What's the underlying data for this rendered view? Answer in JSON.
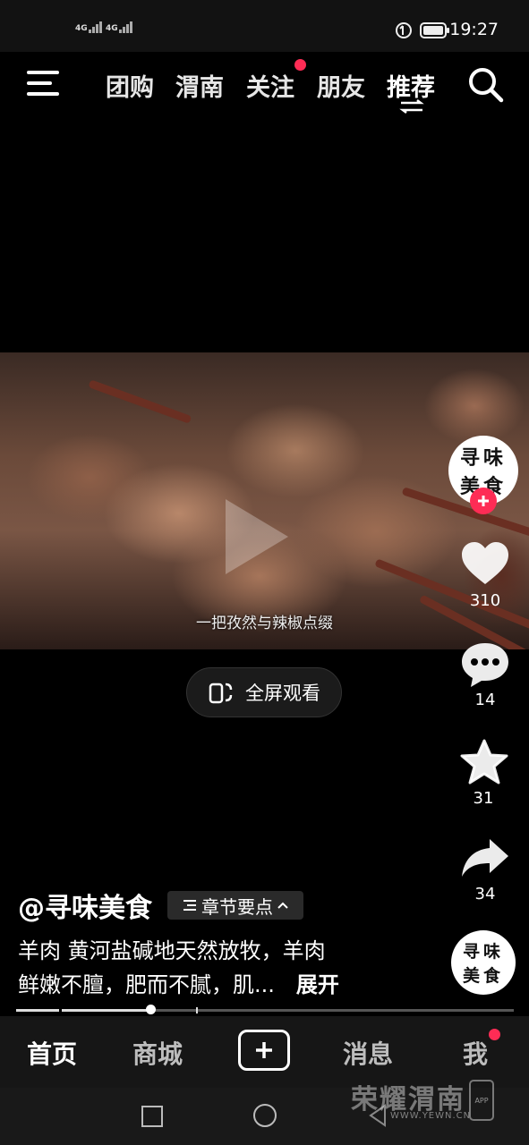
{
  "status_bar": {
    "sim1": "4G",
    "sim2": "4G",
    "time": "19:27"
  },
  "top_nav": {
    "tabs": [
      {
        "label": "团购"
      },
      {
        "label": "渭南"
      },
      {
        "label": "关注",
        "has_dot": true
      },
      {
        "label": "朋友"
      },
      {
        "label": "推荐",
        "active": true
      }
    ]
  },
  "video": {
    "subtitle": "一把孜然与辣椒点缀"
  },
  "fullscreen_button": {
    "label": "全屏观看"
  },
  "right_rail": {
    "avatar_text_line1": "寻味",
    "avatar_text_line2": "美食",
    "likes": "310",
    "comments": "14",
    "favorites": "31",
    "shares": "34"
  },
  "post": {
    "author": "@寻味美食",
    "chapter_label": "章节要点",
    "description_line1": "羊肉 黄河盐碱地天然放牧，羊肉",
    "description_line2": "鲜嫩不膻，肥而不腻，肌...",
    "expand_label": "展开"
  },
  "progress": {
    "played_fraction": 0.27
  },
  "bottom_tabs": {
    "home": "首页",
    "mall": "商城",
    "messages": "消息",
    "me": "我"
  },
  "watermark": {
    "text": "荣耀渭南",
    "url": "WWW.YEWN.CN",
    "app_label": "APP"
  },
  "colors": {
    "accent_red": "#fe2c55",
    "background": "#000000"
  },
  "icons": [
    "menu-icon",
    "search-icon",
    "heart-icon",
    "comment-icon",
    "star-icon",
    "share-icon",
    "fullscreen-icon",
    "plus-icon"
  ]
}
